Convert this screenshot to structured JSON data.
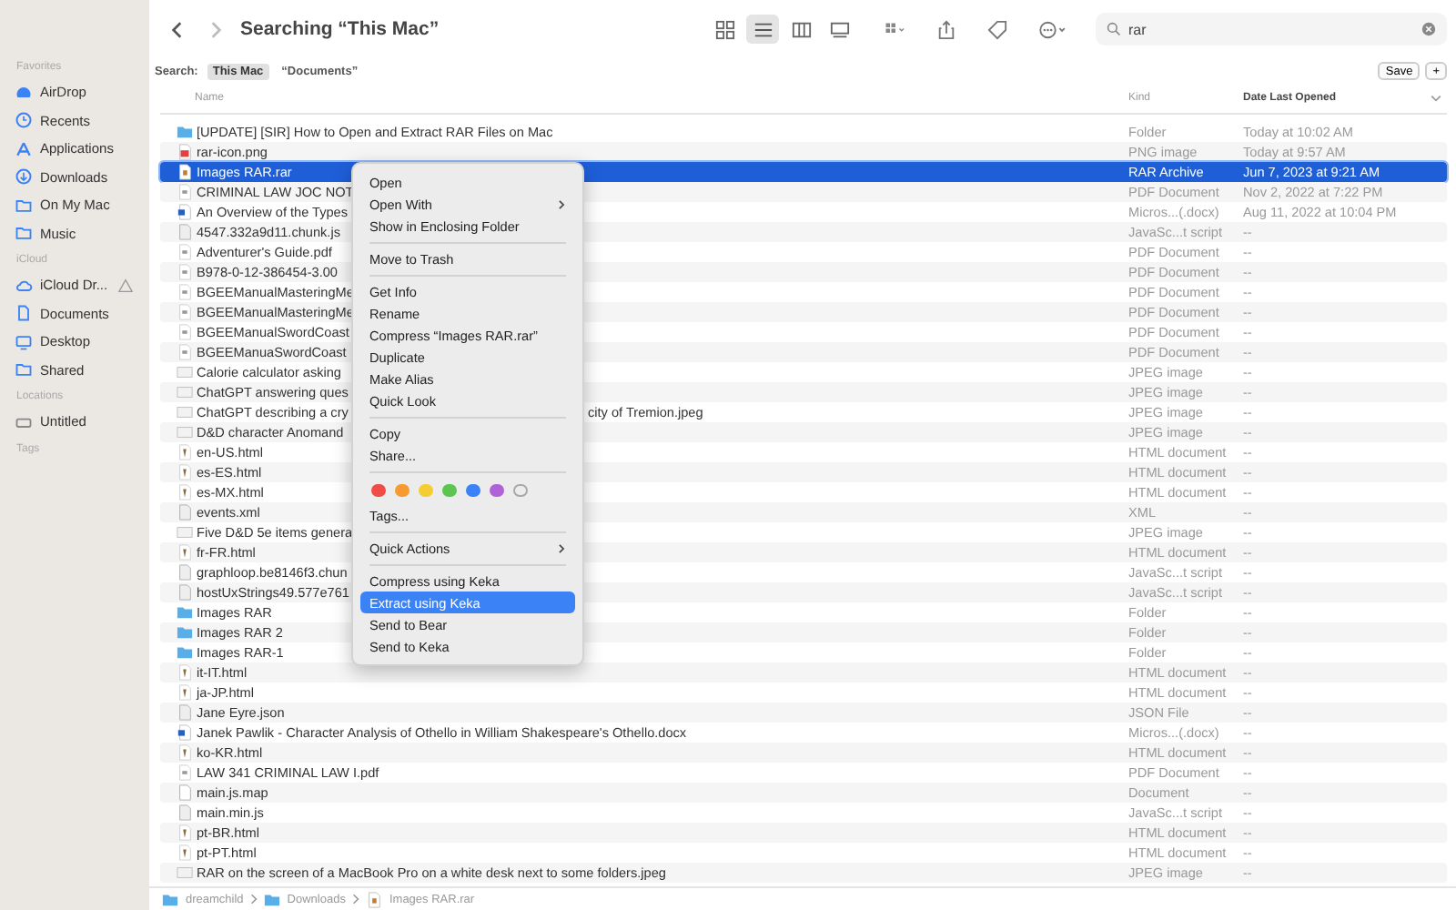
{
  "window": {
    "title": "Searching “This Mac”"
  },
  "sidebar": {
    "sections": [
      {
        "title": "Favorites",
        "items": [
          {
            "label": "AirDrop",
            "kind": "airdrop"
          },
          {
            "label": "Recents",
            "kind": "recents"
          },
          {
            "label": "Applications",
            "kind": "apps"
          },
          {
            "label": "Downloads",
            "kind": "downloads"
          },
          {
            "label": "On My Mac",
            "kind": "folder"
          },
          {
            "label": "Music",
            "kind": "folder"
          }
        ]
      },
      {
        "title": "iCloud",
        "items": [
          {
            "label": "iCloud Dr...",
            "kind": "cloud",
            "warning": true
          },
          {
            "label": "Documents",
            "kind": "doc"
          },
          {
            "label": "Desktop",
            "kind": "desktop"
          },
          {
            "label": "Shared",
            "kind": "shared"
          }
        ]
      },
      {
        "title": "Locations",
        "items": [
          {
            "label": "Untitled",
            "kind": "disk"
          }
        ]
      },
      {
        "title": "Tags"
      }
    ]
  },
  "toolbar": {
    "views": [
      {
        "kind": "grid",
        "selected": false
      },
      {
        "kind": "list",
        "selected": true
      },
      {
        "kind": "columns",
        "selected": false
      },
      {
        "kind": "gallery",
        "selected": false
      }
    ],
    "search": {
      "value": "rar"
    }
  },
  "search_scope": {
    "label": "Search:",
    "scopes": [
      {
        "label": "This Mac",
        "selected": true
      },
      {
        "label": "“Documents”",
        "selected": false
      }
    ],
    "save": "Save",
    "add": "+"
  },
  "table": {
    "columns": [
      {
        "label": "Name",
        "sorted": false
      },
      {
        "label": "Kind",
        "sorted": false
      },
      {
        "label": "Date Last Opened",
        "sorted": true
      }
    ],
    "rows": [
      {
        "kind": "folder",
        "name": "[UPDATE] [SIR] How to Open and Extract RAR Files on Mac",
        "type": "Folder",
        "date": "Today at 10:02 AM",
        "selected": false
      },
      {
        "kind": "image",
        "name": "rar-icon.png",
        "type": "PNG image",
        "date": "Today at 9:57 AM",
        "selected": false
      },
      {
        "kind": "archive",
        "name": "Images RAR.rar",
        "type": "RAR Archive",
        "date": "Jun 7, 2023 at 9:21 AM",
        "selected": true
      },
      {
        "kind": "pdf",
        "name": "CRIMINAL LAW JOC NOT",
        "type": "PDF Document",
        "date": "Nov 2, 2022 at 7:22 PM",
        "selected": false
      },
      {
        "kind": "doc",
        "name": "An Overview of the Types",
        "type": "Micros...(.docx)",
        "date": "Aug 11, 2022 at 10:04 PM",
        "selected": false
      },
      {
        "kind": "script",
        "name": "4547.332a9d11.chunk.js",
        "type": "JavaSc...t script",
        "date": "--",
        "selected": false
      },
      {
        "kind": "pdf",
        "name": "Adventurer's Guide.pdf",
        "type": "PDF Document",
        "date": "--",
        "selected": false
      },
      {
        "kind": "pdf",
        "name": "B978-0-12-386454-3.00",
        "type": "PDF Document",
        "date": "--",
        "selected": false
      },
      {
        "kind": "pdf",
        "name": "BGEEManualMasteringMe",
        "type": "PDF Document",
        "date": "--",
        "selected": false
      },
      {
        "kind": "pdf",
        "name": "BGEEManualMasteringMe",
        "type": "PDF Document",
        "date": "--",
        "selected": false
      },
      {
        "kind": "pdf",
        "name": "BGEEManualSwordCoast",
        "type": "PDF Document",
        "date": "--",
        "selected": false
      },
      {
        "kind": "pdf",
        "name": "BGEEManuaSwordCoast",
        "type": "PDF Document",
        "date": "--",
        "selected": false
      },
      {
        "kind": "photo",
        "name": "Calorie calculator asking",
        "type": "JPEG image",
        "date": "--",
        "selected": false
      },
      {
        "kind": "photo",
        "name": "ChatGPT answering ques",
        "type": "JPEG image",
        "date": "--",
        "selected": false
      },
      {
        "kind": "photo",
        "name": "ChatGPT describing a cry",
        "name_end": "city of Tremion.jpeg",
        "type": "JPEG image",
        "date": "--",
        "selected": false
      },
      {
        "kind": "photo",
        "name": "D&D character Anomand",
        "type": "JPEG image",
        "date": "--",
        "selected": false
      },
      {
        "kind": "html",
        "name": "en-US.html",
        "type": "HTML document",
        "date": "--",
        "selected": false
      },
      {
        "kind": "html",
        "name": "es-ES.html",
        "type": "HTML document",
        "date": "--",
        "selected": false
      },
      {
        "kind": "html",
        "name": "es-MX.html",
        "type": "HTML document",
        "date": "--",
        "selected": false
      },
      {
        "kind": "xml",
        "name": "events.xml",
        "type": "XML",
        "date": "--",
        "selected": false
      },
      {
        "kind": "photo",
        "name": "Five D&D 5e items genera",
        "type": "JPEG image",
        "date": "--",
        "selected": false
      },
      {
        "kind": "html",
        "name": "fr-FR.html",
        "type": "HTML document",
        "date": "--",
        "selected": false
      },
      {
        "kind": "script",
        "name": "graphloop.be8146f3.chun",
        "type": "JavaSc...t script",
        "date": "--",
        "selected": false
      },
      {
        "kind": "script",
        "name": "hostUxStrings49.577e761",
        "type": "JavaSc...t script",
        "date": "--",
        "selected": false
      },
      {
        "kind": "folder",
        "name": "Images RAR",
        "type": "Folder",
        "date": "--",
        "selected": false
      },
      {
        "kind": "folder",
        "name": "Images RAR 2",
        "type": "Folder",
        "date": "--",
        "selected": false
      },
      {
        "kind": "folder",
        "name": "Images RAR-1",
        "type": "Folder",
        "date": "--",
        "selected": false
      },
      {
        "kind": "html",
        "name": "it-IT.html",
        "type": "HTML document",
        "date": "--",
        "selected": false
      },
      {
        "kind": "html",
        "name": "ja-JP.html",
        "type": "HTML document",
        "date": "--",
        "selected": false
      },
      {
        "kind": "script",
        "name": "Jane Eyre.json",
        "type": "JSON File",
        "date": "--",
        "selected": false
      },
      {
        "kind": "doc",
        "name": "Janek Pawlik - Character Analysis of Othello in William Shakespeare's Othello.docx",
        "type": "Micros...(.docx)",
        "date": "--",
        "selected": false
      },
      {
        "kind": "html",
        "name": "ko-KR.html",
        "type": "HTML document",
        "date": "--",
        "selected": false
      },
      {
        "kind": "pdf",
        "name": "LAW 341 CRIMINAL LAW I.pdf",
        "type": "PDF Document",
        "date": "--",
        "selected": false
      },
      {
        "kind": "blank",
        "name": "main.js.map",
        "type": "Document",
        "date": "--",
        "selected": false
      },
      {
        "kind": "script",
        "name": "main.min.js",
        "type": "JavaSc...t script",
        "date": "--",
        "selected": false
      },
      {
        "kind": "html",
        "name": "pt-BR.html",
        "type": "HTML document",
        "date": "--",
        "selected": false
      },
      {
        "kind": "html",
        "name": "pt-PT.html",
        "type": "HTML document",
        "date": "--",
        "selected": false
      },
      {
        "kind": "photo",
        "name": "RAR on the screen of a MacBook Pro on a white desk next to some folders.jpeg",
        "type": "JPEG image",
        "date": "--",
        "selected": false
      }
    ]
  },
  "context_menu": [
    {
      "kind": "item",
      "label": "Open",
      "submenu": false,
      "selected": false
    },
    {
      "kind": "item",
      "label": "Open With",
      "submenu": true,
      "selected": false
    },
    {
      "kind": "item",
      "label": "Show in Enclosing Folder",
      "submenu": false,
      "selected": false
    },
    {
      "kind": "separator"
    },
    {
      "kind": "item",
      "label": "Move to Trash",
      "submenu": false,
      "selected": false
    },
    {
      "kind": "separator"
    },
    {
      "kind": "item",
      "label": "Get Info",
      "submenu": false,
      "selected": false
    },
    {
      "kind": "item",
      "label": "Rename",
      "submenu": false,
      "selected": false
    },
    {
      "kind": "item",
      "label": "Compress “Images RAR.rar”",
      "submenu": false,
      "selected": false
    },
    {
      "kind": "item",
      "label": "Duplicate",
      "submenu": false,
      "selected": false
    },
    {
      "kind": "item",
      "label": "Make Alias",
      "submenu": false,
      "selected": false
    },
    {
      "kind": "item",
      "label": "Quick Look",
      "submenu": false,
      "selected": false
    },
    {
      "kind": "separator"
    },
    {
      "kind": "item",
      "label": "Copy",
      "submenu": false,
      "selected": false
    },
    {
      "kind": "item",
      "label": "Share...",
      "submenu": false,
      "selected": false
    },
    {
      "kind": "separator"
    },
    {
      "kind": "tags",
      "dots": [
        {
          "color": "#f04b46",
          "filled": true
        },
        {
          "color": "#f59b32",
          "filled": true
        },
        {
          "color": "#f3cd32",
          "filled": true
        },
        {
          "color": "#5cc450",
          "filled": true
        },
        {
          "color": "#3a82f6",
          "filled": true
        },
        {
          "color": "#b063d8",
          "filled": true
        },
        {
          "color": "#a8a8a8",
          "filled": false
        }
      ]
    },
    {
      "kind": "item",
      "label": "Tags...",
      "submenu": false,
      "selected": false
    },
    {
      "kind": "separator"
    },
    {
      "kind": "item",
      "label": "Quick Actions",
      "submenu": true,
      "selected": false
    },
    {
      "kind": "separator"
    },
    {
      "kind": "item",
      "label": "Compress using Keka",
      "submenu": false,
      "selected": false
    },
    {
      "kind": "item",
      "label": "Extract using Keka",
      "submenu": false,
      "selected": true
    },
    {
      "kind": "item",
      "label": "Send to Bear",
      "submenu": false,
      "selected": false
    },
    {
      "kind": "item",
      "label": "Send to Keka",
      "submenu": false,
      "selected": false
    }
  ],
  "path_bar": [
    {
      "label": "dreamchild",
      "kind": "folder"
    },
    {
      "label": "Downloads",
      "kind": "folder"
    },
    {
      "label": "Images RAR.rar",
      "kind": "archive"
    }
  ]
}
